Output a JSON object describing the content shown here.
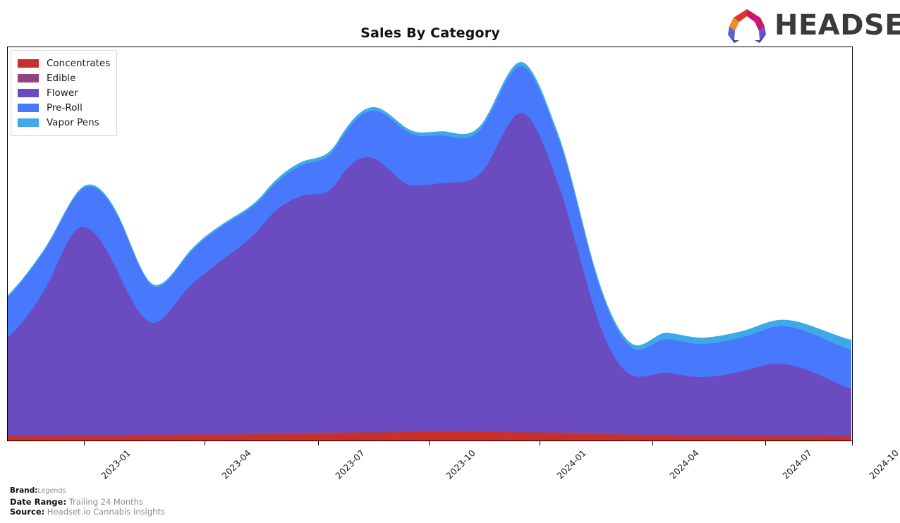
{
  "header": {
    "title": "Sales By Category",
    "logo_text": "HEADSET",
    "logo_icon": "headset-logo-icon"
  },
  "legend": {
    "position": "top-left",
    "items": [
      {
        "label": "Concentrates",
        "color": "#c9302c"
      },
      {
        "label": "Edible",
        "color": "#93447f"
      },
      {
        "label": "Flower",
        "color": "#6a4cc0"
      },
      {
        "label": "Pre-Roll",
        "color": "#4878fc"
      },
      {
        "label": "Vapor Pens",
        "color": "#3fa9e8"
      }
    ]
  },
  "footer": {
    "brand_key": "Brand:",
    "brand_value": "Legends",
    "date_range_key": "Date Range:",
    "date_range_value": "Trailing 24 Months",
    "source_key": "Source:",
    "source_value": "Headset.io Cannabis Insights"
  },
  "chart_data": {
    "type": "area",
    "stacked": true,
    "title": "Sales By Category",
    "xlabel": "",
    "ylabel": "",
    "grid": false,
    "legend_position": "upper left",
    "x": [
      "2022-11",
      "2022-12",
      "2023-01",
      "2023-02",
      "2023-03",
      "2023-04",
      "2023-05",
      "2023-06",
      "2023-07",
      "2023-08",
      "2023-09",
      "2023-10",
      "2023-11",
      "2023-12",
      "2024-01",
      "2024-02",
      "2024-03",
      "2024-04",
      "2024-05",
      "2024-06",
      "2024-07",
      "2024-08",
      "2024-09",
      "2024-10"
    ],
    "tick_labels": [
      "2023-01",
      "2023-04",
      "2023-07",
      "2023-10",
      "2024-01",
      "2024-04",
      "2024-07",
      "2024-10"
    ],
    "ylim": [
      0,
      100
    ],
    "series": [
      {
        "name": "Concentrates",
        "color": "#c9302c",
        "values": [
          0.2,
          0.2,
          0.3,
          0.3,
          0.4,
          0.5,
          0.6,
          0.8,
          1.0,
          1.2,
          1.1,
          1.0,
          1.3,
          1.4,
          0.9,
          0.6,
          0.4,
          0.3,
          0.3,
          0.3,
          0.3,
          0.3,
          0.3,
          0.3
        ]
      },
      {
        "name": "Edible",
        "color": "#93447f",
        "values": [
          0.1,
          0.1,
          0.1,
          0.1,
          0.1,
          0.1,
          0.1,
          0.1,
          0.1,
          0.1,
          0.1,
          0.1,
          0.1,
          0.1,
          0.1,
          0.1,
          0.1,
          0.1,
          0.1,
          0.1,
          0.1,
          0.1,
          0.1,
          0.1
        ]
      },
      {
        "name": "Flower",
        "color": "#6a4cc0",
        "values": [
          36.5,
          45.5,
          54.0,
          48.0,
          39.8,
          44.5,
          49.5,
          56.5,
          62.5,
          70.0,
          67.0,
          62.5,
          64.5,
          64.0,
          78.5,
          70.0,
          47.0,
          30.5,
          27.0,
          26.5,
          27.5,
          29.5,
          28.5,
          26.0
        ]
      },
      {
        "name": "Pre-Roll",
        "color": "#4878fc",
        "values": [
          9.5,
          11.5,
          12.5,
          10.5,
          10.5,
          11.5,
          11.5,
          12.5,
          13.0,
          14.5,
          13.5,
          12.0,
          11.0,
          11.0,
          14.5,
          13.5,
          9.5,
          4.0,
          2.6,
          2.4,
          2.4,
          2.6,
          2.3,
          2.2
        ]
      },
      {
        "name": "Vapor Pens",
        "color": "#3fa9e8",
        "values": [
          0.4,
          0.4,
          0.4,
          0.4,
          0.4,
          0.5,
          0.7,
          1.0,
          1.2,
          1.3,
          1.5,
          1.6,
          1.5,
          1.3,
          1.2,
          1.3,
          1.4,
          1.6,
          1.8,
          2.0,
          2.1,
          2.0,
          1.8,
          1.6
        ]
      }
    ]
  }
}
